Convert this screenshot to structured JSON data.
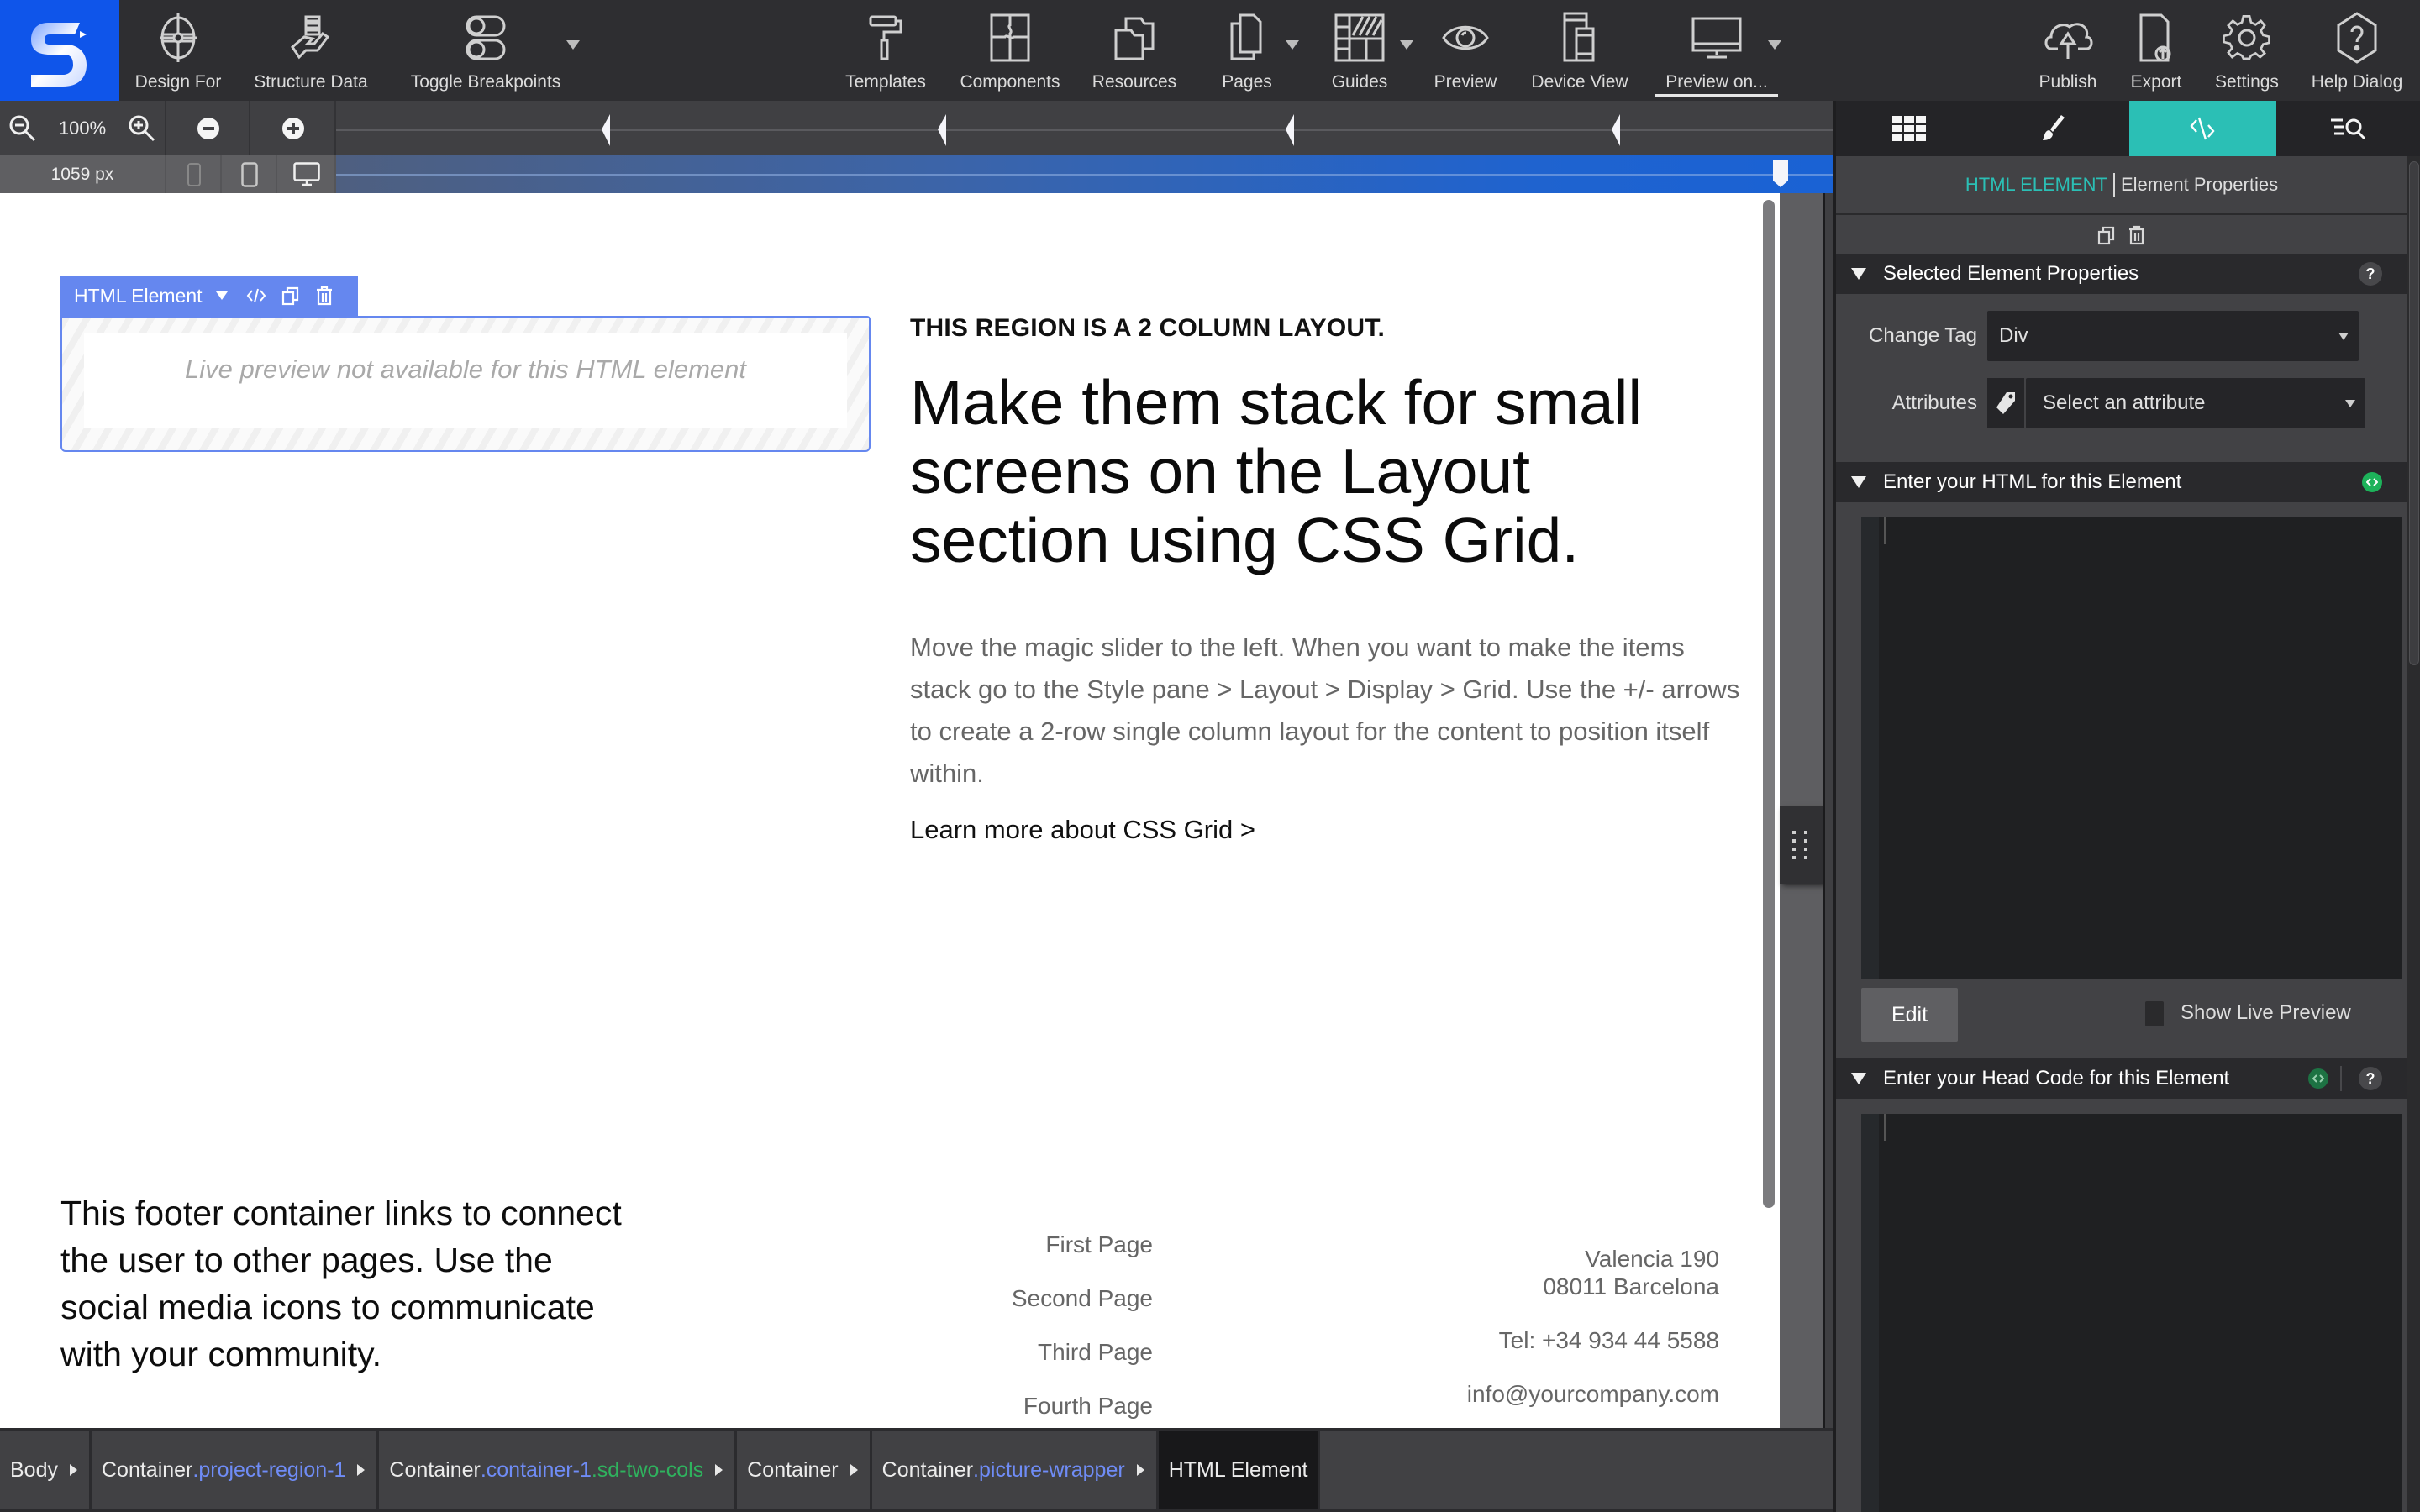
{
  "app": {
    "brand_color": "#0f55ea",
    "accent_color": "#2bbfb5",
    "selection_color": "#6587ef"
  },
  "toolbar": {
    "left": [
      {
        "id": "design-for",
        "label": "Design For",
        "icon": "crosshair-icon"
      },
      {
        "id": "structure-data",
        "label": "Structure Data",
        "icon": "hand-coins-icon"
      },
      {
        "id": "toggle-breakpoints",
        "label": "Toggle Breakpoints",
        "icon": "toggle-icon",
        "has_dropdown": true
      }
    ],
    "center": [
      {
        "id": "templates",
        "label": "Templates",
        "icon": "paint-roller-icon"
      },
      {
        "id": "components",
        "label": "Components",
        "icon": "puzzle-icon"
      },
      {
        "id": "resources",
        "label": "Resources",
        "icon": "folders-icon"
      },
      {
        "id": "pages",
        "label": "Pages",
        "icon": "pages-icon",
        "has_dropdown": true
      },
      {
        "id": "guides",
        "label": "Guides",
        "icon": "guides-icon",
        "has_dropdown": true
      },
      {
        "id": "preview",
        "label": "Preview",
        "icon": "eye-icon"
      },
      {
        "id": "device-view",
        "label": "Device View",
        "icon": "devices-icon"
      },
      {
        "id": "preview-on",
        "label": "Preview on...",
        "icon": "monitor-icon",
        "has_dropdown": true,
        "active": true
      }
    ],
    "right": [
      {
        "id": "publish",
        "label": "Publish",
        "icon": "cloud-upload-icon"
      },
      {
        "id": "export",
        "label": "Export",
        "icon": "file-export-icon"
      },
      {
        "id": "settings",
        "label": "Settings",
        "icon": "gear-icon"
      },
      {
        "id": "help-dialog",
        "label": "Help Dialog",
        "icon": "help-hexagon-icon"
      }
    ]
  },
  "zoom": {
    "level": "100%",
    "width_readout": "1059 px"
  },
  "breakpoints": {
    "count": 4
  },
  "canvas": {
    "element_toolbar": {
      "label": "HTML Element"
    },
    "html_placeholder": "Live preview not available for this HTML element",
    "eyebrow": "THIS REGION IS A 2 COLUMN LAYOUT.",
    "headline": "Make them stack for small screens on the Layout section using CSS Grid.",
    "paragraph": "Move the magic slider to the left. When you want to make the items stack go to the Style pane > Layout > Display > Grid. Use the +/- arrows to create a 2-row single column layout for the content to position itself within.",
    "learn_more": "Learn more about CSS Grid >",
    "footer": {
      "blurb": "This footer container links to connect the user to other pages. Use the social media icons to communicate with your community.",
      "links": [
        "First Page",
        "Second Page",
        "Third Page",
        "Fourth Page"
      ],
      "address_line1": "Valencia 190",
      "address_line2": "08011 Barcelona",
      "phone": "Tel: +34 934 44 5588",
      "email": "info@yourcompany.com"
    }
  },
  "breadcrumb": [
    {
      "base": "Body",
      "cls": "",
      "cls_color": ""
    },
    {
      "base": "Container",
      "cls": ".project-region-1",
      "cls_color": "blue"
    },
    {
      "base": "Container",
      "cls": ".container-1",
      "cls2": ".sd-two-cols",
      "cls_color": "blue",
      "cls2_color": "green"
    },
    {
      "base": "Container",
      "cls": "",
      "cls_color": ""
    },
    {
      "base": "Container",
      "cls": ".picture-wrapper",
      "cls_color": "blue"
    },
    {
      "base": "HTML Element",
      "current": true
    }
  ],
  "panel": {
    "tabs": [
      {
        "id": "layout",
        "icon": "grid-icon"
      },
      {
        "id": "style",
        "icon": "brush-icon"
      },
      {
        "id": "code",
        "icon": "code-icon",
        "active": true
      },
      {
        "id": "search",
        "icon": "list-search-icon"
      }
    ],
    "title_accent": "HTML ELEMENT",
    "title_rest": "Element Properties",
    "sections": {
      "selected": {
        "title": "Selected Element Properties"
      },
      "html": {
        "title": "Enter your HTML for this Element"
      },
      "head": {
        "title": "Enter your Head Code for this Element"
      }
    },
    "change_tag": {
      "label": "Change Tag",
      "value": "Div"
    },
    "attributes": {
      "label": "Attributes",
      "placeholder": "Select an attribute"
    },
    "edit_button": "Edit",
    "show_live_preview": {
      "label": "Show Live Preview",
      "checked": false
    },
    "html_code": "",
    "head_code": ""
  }
}
